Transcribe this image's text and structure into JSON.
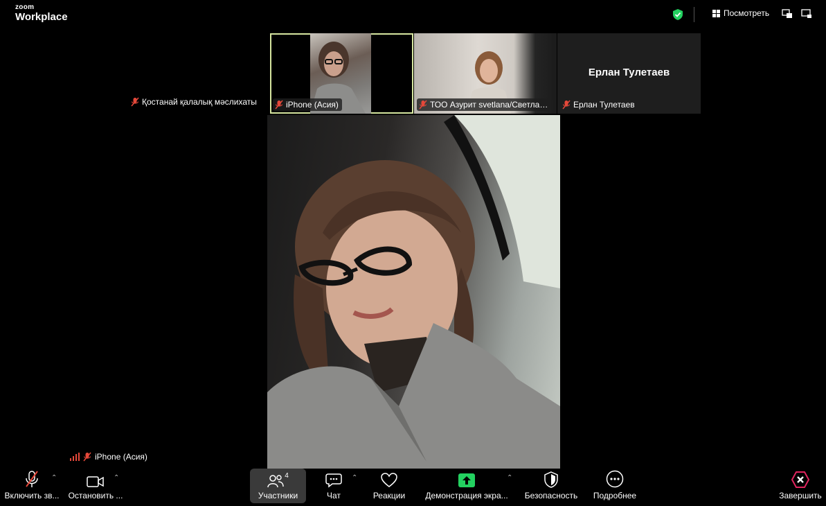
{
  "app": {
    "logo_line1": "zoom",
    "logo_line2": "Workplace"
  },
  "topbar": {
    "view_label": "Посмотреть",
    "security_shield": "shield-check-icon"
  },
  "tiles": [
    {
      "name": "Қостанай қалалық мәслихаты",
      "muted": true
    },
    {
      "name": "iPhone (Асия)",
      "muted": true,
      "active_speaker": true
    },
    {
      "name": "ТОО Азурит svetlana/Светлана...",
      "muted": true
    },
    {
      "name": "Ерлан Тулетаев",
      "muted": true,
      "display_name": "Ерлан Тулетаев"
    }
  ],
  "main_video": {
    "speaker_label": "iPhone (Асия)"
  },
  "toolbar": {
    "audio_label": "Включить зв...",
    "video_label": "Остановить ...",
    "participants_label": "Участники",
    "participants_count": "4",
    "chat_label": "Чат",
    "reactions_label": "Реакции",
    "share_label": "Демонстрация экра...",
    "security_label": "Безопасность",
    "more_label": "Подробнее",
    "end_label": "Завершить"
  },
  "colors": {
    "accent_green": "#23d160",
    "end_red": "#e0245e",
    "active_border": "#d7e7a0",
    "mute_red": "#e5483a"
  }
}
